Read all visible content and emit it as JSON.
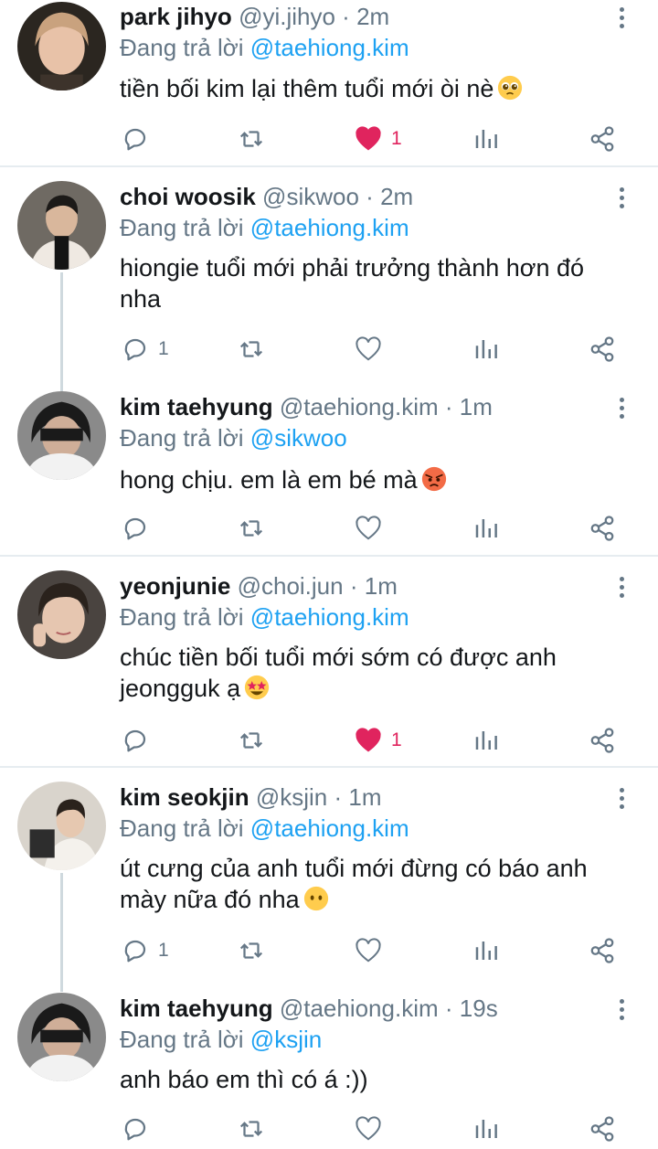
{
  "reply_prefix": "Đang trả lời",
  "dot": "·",
  "colors": {
    "accent": "#1da1f2",
    "like": "#e0245e",
    "muted": "#657786",
    "separator": "#e6ecf0"
  },
  "icons": {
    "reply": "reply-icon",
    "retweet": "retweet-icon",
    "like": "heart-icon",
    "stats": "stats-icon",
    "share": "share-icon",
    "more": "more-options-icon"
  },
  "tweets": [
    {
      "name": "park jihyo",
      "handle": "@yi.jihyo",
      "time": "2m",
      "reply_to": "@taehiong.kim",
      "text": "tiền bối kim lại thêm tuổi mới òi nè",
      "emoji": "pleading-face",
      "replies": "",
      "likes": "1",
      "liked": true
    },
    {
      "name": "choi woosik",
      "handle": "@sikwoo",
      "time": "2m",
      "reply_to": "@taehiong.kim",
      "text": "hiongie tuổi mới phải trưởng thành hơn đó nha",
      "emoji": "",
      "replies": "1",
      "likes": "",
      "liked": false
    },
    {
      "name": "kim taehyung",
      "handle": "@taehiong.kim",
      "time": "1m",
      "reply_to": "@sikwoo",
      "text": "hong chịu. em là em bé mà",
      "emoji": "angry-face",
      "replies": "",
      "likes": "",
      "liked": false
    },
    {
      "name": "yeonjunie",
      "handle": "@choi.jun",
      "time": "1m",
      "reply_to": "@taehiong.kim",
      "text": "chúc tiền bối tuổi mới sớm có được anh jeongguk ạ",
      "emoji": "star-struck-face",
      "replies": "",
      "likes": "1",
      "liked": true
    },
    {
      "name": "kim seokjin",
      "handle": "@ksjin",
      "time": "1m",
      "reply_to": "@taehiong.kim",
      "text": "út cưng của anh tuổi mới đừng có báo anh mày nữa đó nha",
      "emoji": "no-mouth-face",
      "replies": "1",
      "likes": "",
      "liked": false
    },
    {
      "name": "kim taehyung",
      "handle": "@taehiong.kim",
      "time": "19s",
      "reply_to": "@ksjin",
      "text": "anh báo em thì có á :))",
      "emoji": "",
      "replies": "",
      "likes": "",
      "liked": false
    }
  ]
}
